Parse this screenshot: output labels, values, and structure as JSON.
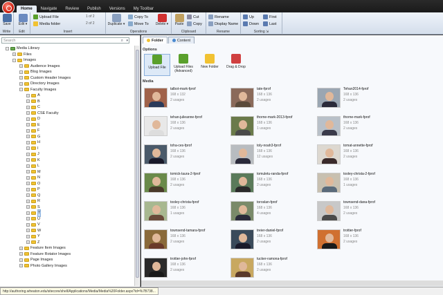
{
  "tabs": [
    {
      "label": "Home",
      "active": true
    },
    {
      "label": "Navigate"
    },
    {
      "label": "Review"
    },
    {
      "label": "Publish"
    },
    {
      "label": "Versions"
    },
    {
      "label": "My Toolbar"
    }
  ],
  "ribbon": {
    "save": "Save",
    "edit": "Edit",
    "write_label": "Write",
    "edit_label": "Edit",
    "upload_file": "Upload File",
    "media_folder": "Media folder",
    "page_1": "1 of 2",
    "page_2": "2 of 2",
    "insert_label": "Insert",
    "duplicate": "Duplicate",
    "copy_to": "Copy To",
    "move_to": "Move To",
    "delete": "Delete",
    "operations_label": "Operations",
    "paste": "Paste",
    "cut": "Cut",
    "copy": "Copy",
    "clipboard_label": "Clipboard",
    "rename": "Rename",
    "display_name": "Display Name",
    "rename_label": "Rename",
    "up": "Up",
    "down": "Down",
    "first": "First",
    "last": "Last",
    "sorting_label": "Sorting"
  },
  "search": {
    "placeholder": "Search"
  },
  "tree": [
    {
      "label": "Media Library",
      "indent": 0,
      "lib": true
    },
    {
      "label": "Files",
      "indent": 1
    },
    {
      "label": "Images",
      "indent": 1
    },
    {
      "label": "Audience Images",
      "indent": 2
    },
    {
      "label": "Blog Images",
      "indent": 2
    },
    {
      "label": "Custom Header Images",
      "indent": 2
    },
    {
      "label": "Directory Images",
      "indent": 2
    },
    {
      "label": "Faculty Images",
      "indent": 2
    },
    {
      "label": "A",
      "indent": 3
    },
    {
      "label": "B",
      "indent": 3
    },
    {
      "label": "C",
      "indent": 3
    },
    {
      "label": "CSE Faculty",
      "indent": 3
    },
    {
      "label": "D",
      "indent": 3
    },
    {
      "label": "E",
      "indent": 3
    },
    {
      "label": "F",
      "indent": 3
    },
    {
      "label": "G",
      "indent": 3
    },
    {
      "label": "H",
      "indent": 3
    },
    {
      "label": "I",
      "indent": 3
    },
    {
      "label": "J",
      "indent": 3
    },
    {
      "label": "K",
      "indent": 3
    },
    {
      "label": "L",
      "indent": 3
    },
    {
      "label": "M",
      "indent": 3
    },
    {
      "label": "N",
      "indent": 3
    },
    {
      "label": "O",
      "indent": 3
    },
    {
      "label": "P",
      "indent": 3
    },
    {
      "label": "Q",
      "indent": 3
    },
    {
      "label": "R",
      "indent": 3
    },
    {
      "label": "S",
      "indent": 3
    },
    {
      "label": "T",
      "indent": 3,
      "selected": true
    },
    {
      "label": "U",
      "indent": 3
    },
    {
      "label": "V",
      "indent": 3
    },
    {
      "label": "W",
      "indent": 3
    },
    {
      "label": "Y",
      "indent": 3
    },
    {
      "label": "Z",
      "indent": 3
    },
    {
      "label": "Feature Item Images",
      "indent": 2
    },
    {
      "label": "Feature Rotator Images",
      "indent": 2
    },
    {
      "label": "Page Images",
      "indent": 2
    },
    {
      "label": "Photo Gallery Images",
      "indent": 2
    }
  ],
  "panel_tabs": [
    {
      "label": "Folder",
      "active": true
    },
    {
      "label": "Content"
    }
  ],
  "options_label": "Options",
  "options": [
    {
      "label": "Upload File",
      "selected": true,
      "color": "#5aa02c"
    },
    {
      "label": "Upload Files (Advanced)",
      "color": "#5aa02c"
    },
    {
      "label": "New Folder",
      "color": "#f1c232"
    },
    {
      "label": "Drag & Drop",
      "color": "#d04040"
    }
  ],
  "media_label": "Media",
  "media": [
    {
      "name": "talbot-mark-fprof",
      "dim": "168 x 132",
      "usages": "2 usages",
      "bg": "#a0624a",
      "shirt": "#2a3a5a"
    },
    {
      "name": "tate-fprof",
      "dim": "168 x 136",
      "usages": "2 usages",
      "bg": "#8a6a5a",
      "shirt": "#5a4a3a"
    },
    {
      "name": "Tehan2014-fprof",
      "dim": "168 x 136",
      "usages": "2 usages",
      "bg": "#9aa6b2",
      "shirt": "#2a2a3a"
    },
    {
      "name": "tehan-julieanne-fprof",
      "dim": "168 x 136",
      "usages": "2 usages",
      "bg": "#e8e8e8",
      "shirt": "#dddddd"
    },
    {
      "name": "thorne-mark-2013-fprof",
      "dim": "168 x 136",
      "usages": "1 usages",
      "bg": "#6a7a4a",
      "shirt": "#4a4a4a"
    },
    {
      "name": "thorne-mark-fprof",
      "dim": "168 x 136",
      "usages": "2 usages",
      "bg": "#b8c0c8",
      "shirt": "#3a3a4a"
    },
    {
      "name": "toha-ces-fprof",
      "dim": "168 x 136",
      "usages": "2 usages",
      "bg": "#4a5a6a",
      "shirt": "#1a1a2a"
    },
    {
      "name": "toly-noah3-fprof",
      "dim": "168 x 136",
      "usages": "12 usages",
      "bg": "#b8bcc0",
      "shirt": "#2a2a3a"
    },
    {
      "name": "tomat-annette-fprof",
      "dim": "168 x 136",
      "usages": "2 usages",
      "bg": "#ddd8d0",
      "shirt": "#3a2a2a"
    },
    {
      "name": "tomick-laura-2-fprof",
      "dim": "168 x 136",
      "usages": "2 usages",
      "bg": "#6a8a4a",
      "shirt": "#4a3a2a"
    },
    {
      "name": "tomuletu-randa-fprof",
      "dim": "168 x 136",
      "usages": "2 usages",
      "bg": "#5a7a5a",
      "shirt": "#2a2a2a"
    },
    {
      "name": "tooley-christa-2-fprof",
      "dim": "168 x 136",
      "usages": "1 usages",
      "bg": "#c8c0b0",
      "shirt": "#5a6a7a"
    },
    {
      "name": "tooley-christa-fprof",
      "dim": "168 x 136",
      "usages": "1 usages",
      "bg": "#a8b890",
      "shirt": "#6a4a3a"
    },
    {
      "name": "toroslan-fprof",
      "dim": "168 x 136",
      "usages": "4 usages",
      "bg": "#7a8a6a",
      "shirt": "#2a2a3a"
    },
    {
      "name": "townsend-dana-fprof",
      "dim": "168 x 136",
      "usages": "2 usages",
      "bg": "#c8c8c8",
      "shirt": "#4a4a4a"
    },
    {
      "name": "townsend-tamara-fprof",
      "dim": "168 x 136",
      "usages": "2 usages",
      "bg": "#8a6a3a",
      "shirt": "#6a3a2a"
    },
    {
      "name": "treier-daniel-fprof",
      "dim": "168 x 136",
      "usages": "2 usages",
      "bg": "#3a4a5a",
      "shirt": "#1a1a2a"
    },
    {
      "name": "trottier-fprof",
      "dim": "168 x 136",
      "usages": "2 usages",
      "bg": "#d07030",
      "shirt": "#1a1a1a"
    },
    {
      "name": "trottier-john-fprof",
      "dim": "168 x 136",
      "usages": "2 usages",
      "bg": "#2a2a2a",
      "shirt": "#1a1a1a"
    },
    {
      "name": "tucker-ramona-fprof",
      "dim": "168 x 136",
      "usages": "2 usages",
      "bg": "#c8a860",
      "shirt": "#5a3a2a"
    }
  ],
  "status_url": "http://authoring.wheaton.edu/sitecore/shell/Applications/Media/Media%20Folder.aspx?id=%7B738..."
}
